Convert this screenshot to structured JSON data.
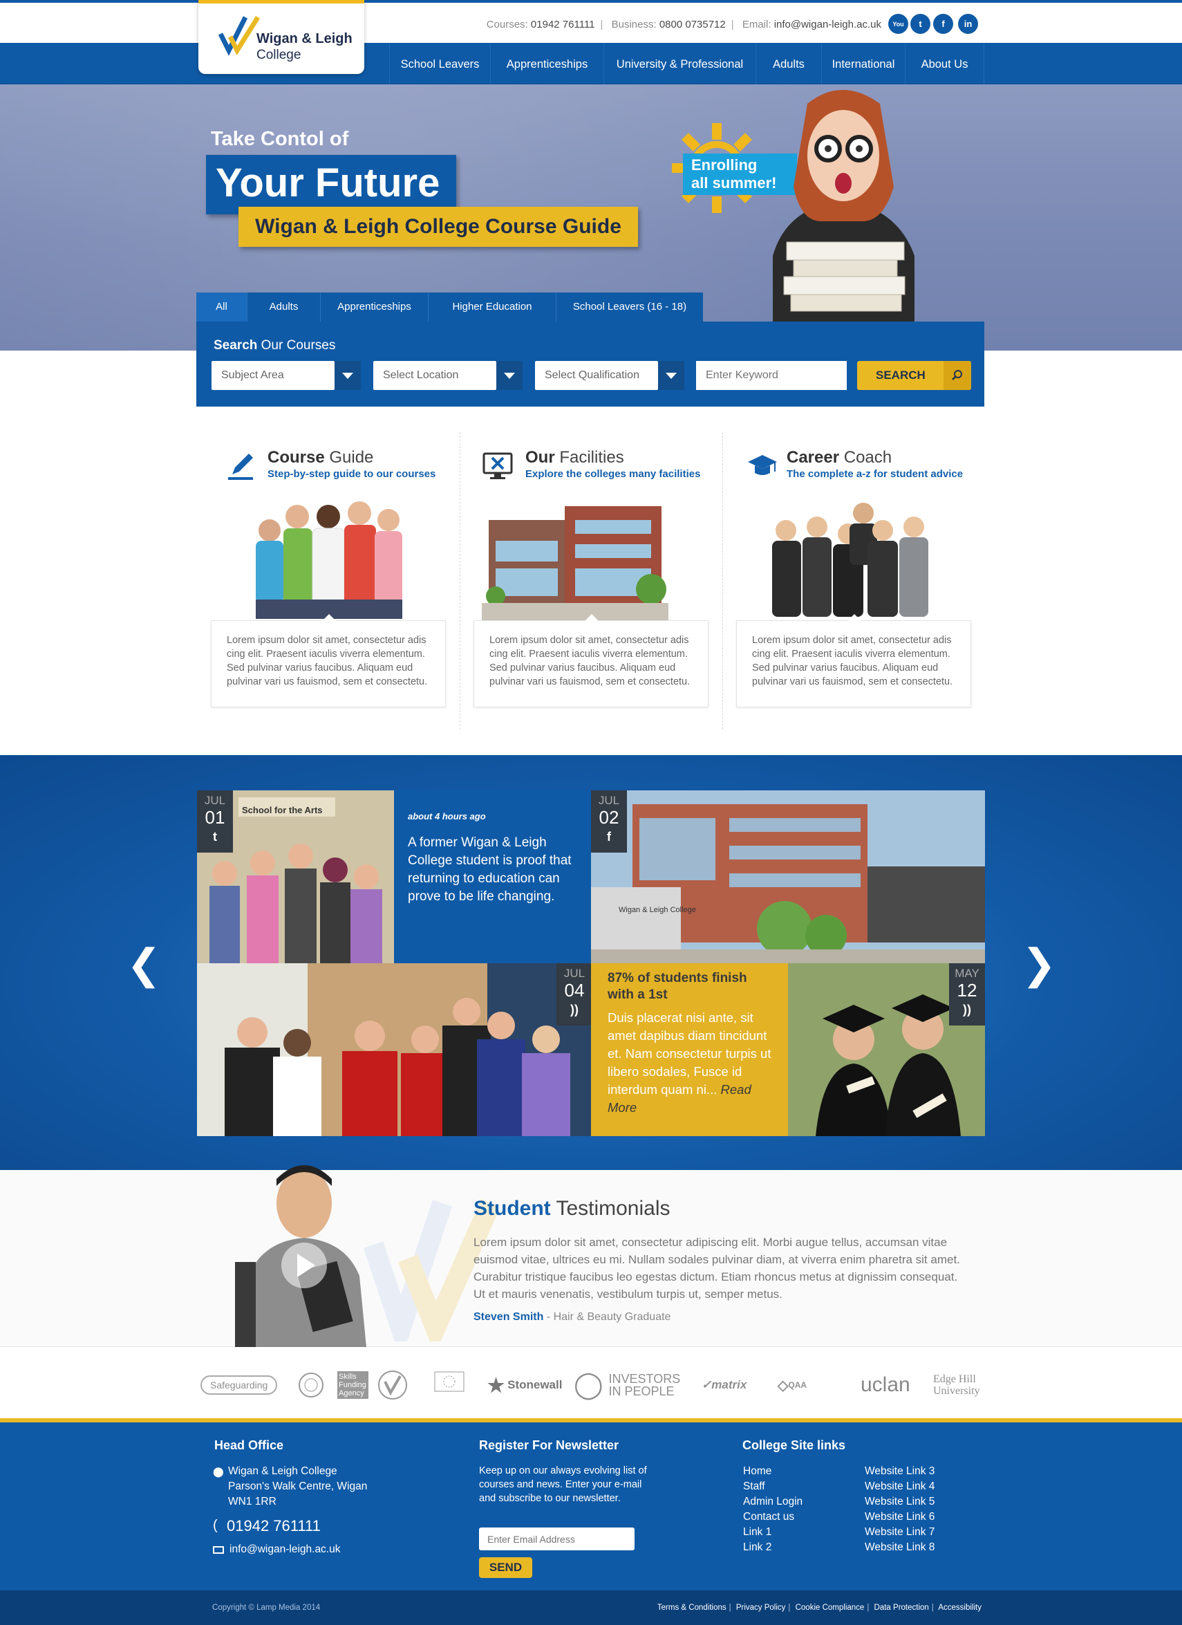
{
  "header": {
    "logo": {
      "line1": "Wigan & Leigh",
      "line2": "College"
    },
    "contact": {
      "courses_label": "Courses:",
      "courses": "01942 761111",
      "business_label": "Business:",
      "business": "0800 0735712",
      "email_label": "Email:",
      "email": "info@wigan-leigh.ac.uk"
    },
    "social": [
      {
        "name": "youtube-icon",
        "glyph": "You"
      },
      {
        "name": "twitter-icon",
        "glyph": "t"
      },
      {
        "name": "facebook-icon",
        "glyph": "f"
      },
      {
        "name": "linkedin-icon",
        "glyph": "in"
      }
    ],
    "nav": [
      "School Leavers",
      "Apprenticeships",
      "University & Professional",
      "Adults",
      "International",
      "About Us"
    ]
  },
  "hero": {
    "kicker": "Take Contol of",
    "headline": "Your Future",
    "subheadline": "Wigan & Leigh College Course Guide",
    "badge_line1": "Enrolling",
    "badge_line2": "all summer!"
  },
  "search": {
    "tabs": [
      "All",
      "Adults",
      "Apprenticeships",
      "Higher Education",
      "School Leavers (16 - 18)"
    ],
    "label_bold": "Search",
    "label_rest": " Our Courses",
    "selects": [
      "Subject Area",
      "Select Location",
      "Select Qualification"
    ],
    "keyword_placeholder": "Enter Keyword",
    "button": "SEARCH"
  },
  "features": [
    {
      "title_bold": "Course",
      "title_rest": " Guide",
      "subtitle": "Step-by-step guide to our courses",
      "text": "Lorem ipsum dolor sit amet, consectetur adis cing elit. Praesent iaculis viverra elementum. Sed pulvinar varius faucibus. Aliquam eud pulvinar vari us fauismod, sem et consectetu."
    },
    {
      "title_bold": "Our",
      "title_rest": " Facilities",
      "subtitle": "Explore the colleges many facilities",
      "text": "Lorem ipsum dolor sit amet, consectetur adis cing elit. Praesent iaculis viverra elementum. Sed pulvinar varius faucibus. Aliquam eud pulvinar vari us fauismod, sem et consectetu."
    },
    {
      "title_bold": "Career",
      "title_rest": " Coach",
      "subtitle": "The complete a-z for student advice",
      "text": "Lorem ipsum dolor sit amet, consectetur adis cing elit. Praesent iaculis viverra elementum. Sed pulvinar varius faucibus. Aliquam eud pulvinar vari us fauismod, sem et consectetu."
    }
  ],
  "news": {
    "tweet_time": "about 4 hours ago",
    "tweet_text": "A former Wigan & Leigh College student is proof that returning to education can prove to be life changing.",
    "photo_sign": "School for the Arts",
    "building_sign": "Wigan & Leigh College",
    "dates": [
      {
        "month": "JUL",
        "day": "01",
        "icon": "twitter-icon",
        "glyph": "t"
      },
      {
        "month": "JUL",
        "day": "02",
        "icon": "facebook-icon",
        "glyph": "f"
      },
      {
        "month": "JUL",
        "day": "04",
        "icon": "rss-icon",
        "glyph": "))"
      },
      {
        "month": "MAY",
        "day": "12",
        "icon": "rss-icon",
        "glyph": "))"
      }
    ],
    "story_title": "87% of students finish with a 1st",
    "story_text": "Duis placerat nisi ante, sit amet dapibus diam tincidunt et. Nam consectetur turpis ut libero sodales, Fusce id  interdum quam ni... ",
    "read_more": "Read More",
    "prev_glyph": "❮",
    "next_glyph": "❯"
  },
  "testimonials": {
    "title_bold": "Student",
    "title_rest": " Testimonials",
    "text": "Lorem ipsum dolor sit amet, consectetur adipiscing elit. Morbi augue tellus, accumsan vitae euismod vitae, ultrices eu mi. Nullam sodales pulvinar diam, at viverra enim pharetra sit amet. Curabitur tristique faucibus leo egestas dictum. Etiam rhoncus metus at dignissim consequat. Ut et mauris venenatis, vestibulum turpis ut, semper metus.",
    "name": "Steven Smith",
    "role": " - Hair & Beauty Graduate"
  },
  "partners": [
    "Safeguarding",
    "Skills Funding Agency",
    "Stonewall",
    "INVESTORS IN PEOPLE",
    "matrix",
    "QAA",
    "uclan",
    "Edge Hill University"
  ],
  "footer": {
    "head_office": {
      "title": "Head Office",
      "address": [
        "Wigan & Leigh College",
        "Parson's Walk Centre, Wigan",
        "WN1 1RR"
      ],
      "phone": "01942 761111",
      "email": "info@wigan-leigh.ac.uk"
    },
    "newsletter": {
      "title": "Register For Newsletter",
      "text": "Keep up on our always evolving list of courses and news. Enter your e-mail and subscribe to our newsletter.",
      "placeholder": "Enter Email Address",
      "button": "SEND"
    },
    "links": {
      "title": "College Site links",
      "col1": [
        "Home",
        "Staff",
        "Admin Login",
        "Contact us",
        "Link 1",
        "Link 2"
      ],
      "col2": [
        "Website Link 3",
        "Website Link 4",
        "Website Link 5",
        "Website Link 6",
        "Website Link 7",
        "Website Link 8"
      ]
    },
    "copyright": "Copyright © Lamp Media 2014",
    "bottom_links": [
      "Terms & Conditions",
      "Privacy Policy",
      "Cookie Compliance",
      "Data Protection",
      "Accessibility"
    ]
  }
}
